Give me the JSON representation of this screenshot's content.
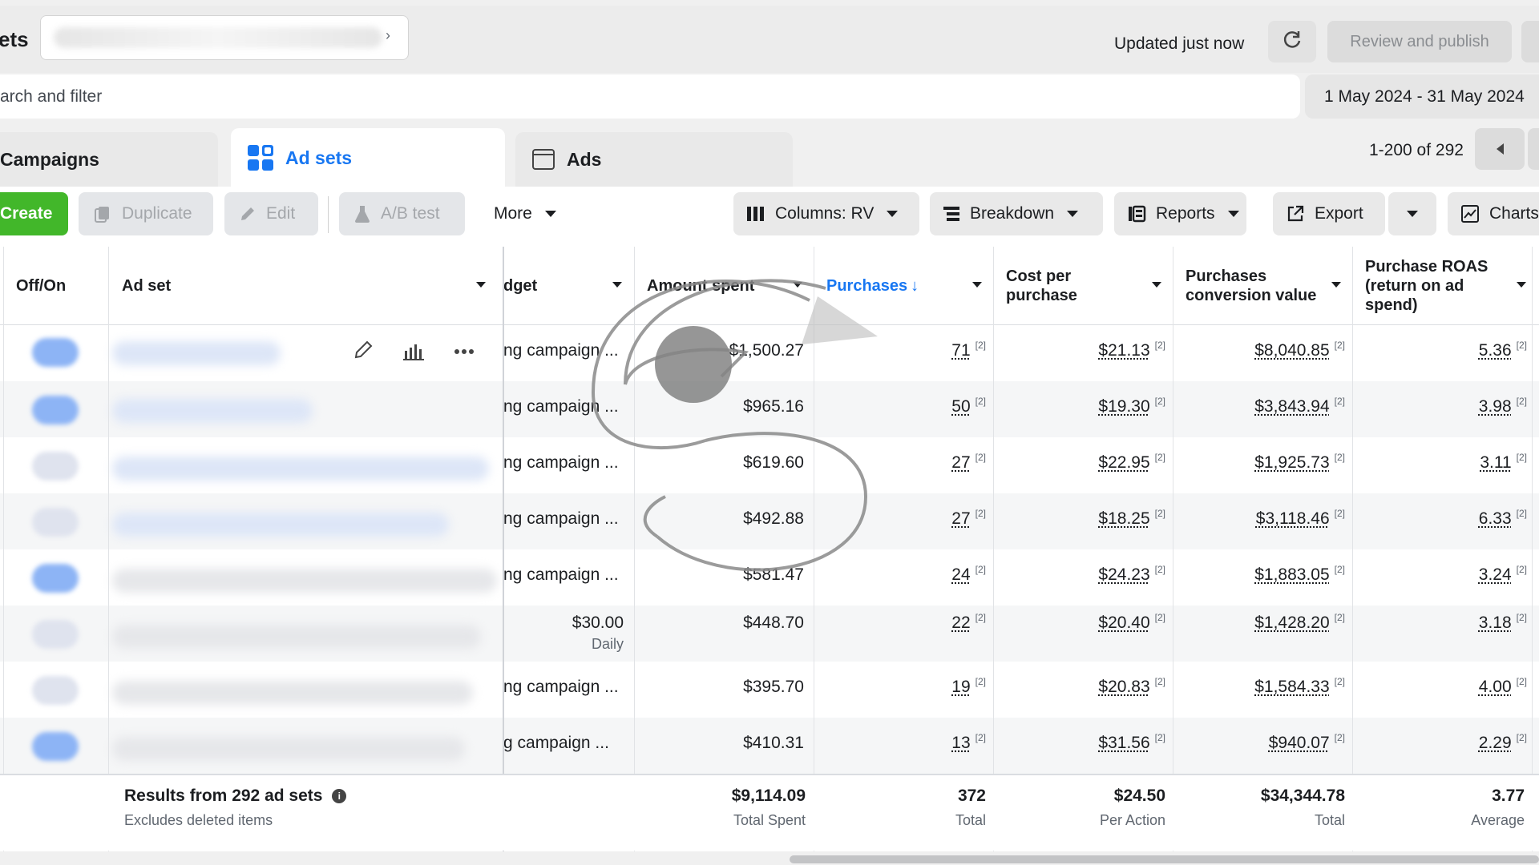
{
  "header": {
    "title": "ets",
    "updated_text": "Updated just now",
    "review_publish": "Review and publish"
  },
  "search": {
    "placeholder": "arch and filter",
    "date_range": "1 May 2024 - 31 May 2024"
  },
  "tabs": [
    {
      "label": "Campaigns"
    },
    {
      "label": "Ad sets"
    },
    {
      "label": "Ads"
    }
  ],
  "pager": {
    "text": "1-200 of 292"
  },
  "toolbar": {
    "create": "Create",
    "duplicate": "Duplicate",
    "edit": "Edit",
    "ab_test": "A/B test",
    "more": "More",
    "columns": "Columns: RV",
    "breakdown": "Breakdown",
    "reports": "Reports",
    "export": "Export",
    "charts": "Charts"
  },
  "columns": {
    "offon": "Off/On",
    "adset": "Ad set",
    "budget": "dget",
    "amount_spent": "Amount spent",
    "purchases": "Purchases",
    "cost_per_purchase": "Cost per purchase",
    "conversion_value": "Purchases conversion value",
    "roas": "Purchase ROAS (return on ad spend)"
  },
  "rows": [
    {
      "budget": "ng campaign ...",
      "spent": "$1,500.27",
      "purchases": "71",
      "cpp": "$21.13",
      "value": "$8,040.85",
      "roas": "5.36",
      "sup": "[2]"
    },
    {
      "budget": "ng campaign ...",
      "spent": "$965.16",
      "purchases": "50",
      "cpp": "$19.30",
      "value": "$3,843.94",
      "roas": "3.98",
      "sup": "[2]"
    },
    {
      "budget": "ng campaign ...",
      "spent": "$619.60",
      "purchases": "27",
      "cpp": "$22.95",
      "value": "$1,925.73",
      "roas": "3.11",
      "sup": "[2]"
    },
    {
      "budget": "ng campaign ...",
      "spent": "$492.88",
      "purchases": "27",
      "cpp": "$18.25",
      "value": "$3,118.46",
      "roas": "6.33",
      "sup": "[2]"
    },
    {
      "budget": "ng campaign ...",
      "spent": "$581.47",
      "purchases": "24",
      "cpp": "$24.23",
      "value": "$1,883.05",
      "roas": "3.24",
      "sup": "[2]"
    },
    {
      "budget": "$30.00",
      "budget_sub": "Daily",
      "spent": "$448.70",
      "purchases": "22",
      "cpp": "$20.40",
      "value": "$1,428.20",
      "roas": "3.18",
      "sup": "[2]"
    },
    {
      "budget": "ng campaign ...",
      "spent": "$395.70",
      "purchases": "19",
      "cpp": "$20.83",
      "value": "$1,584.33",
      "roas": "4.00",
      "sup": "[2]"
    },
    {
      "budget": "g campaign ...",
      "spent": "$410.31",
      "purchases": "13",
      "cpp": "$31.56",
      "value": "$940.07",
      "roas": "2.29",
      "sup": "[2]"
    }
  ],
  "summary": {
    "title": "Results from 292 ad sets",
    "subtitle": "Excludes deleted items",
    "spent": "$9,114.09",
    "spent_label": "Total Spent",
    "purchases": "372",
    "purchases_label": "Total",
    "cpp": "$24.50",
    "cpp_label": "Per Action",
    "value": "$34,344.78",
    "value_label": "Total",
    "roas": "3.77",
    "roas_label": "Average"
  },
  "colors": {
    "accent": "#1877f2",
    "create_green": "#42b72a"
  }
}
